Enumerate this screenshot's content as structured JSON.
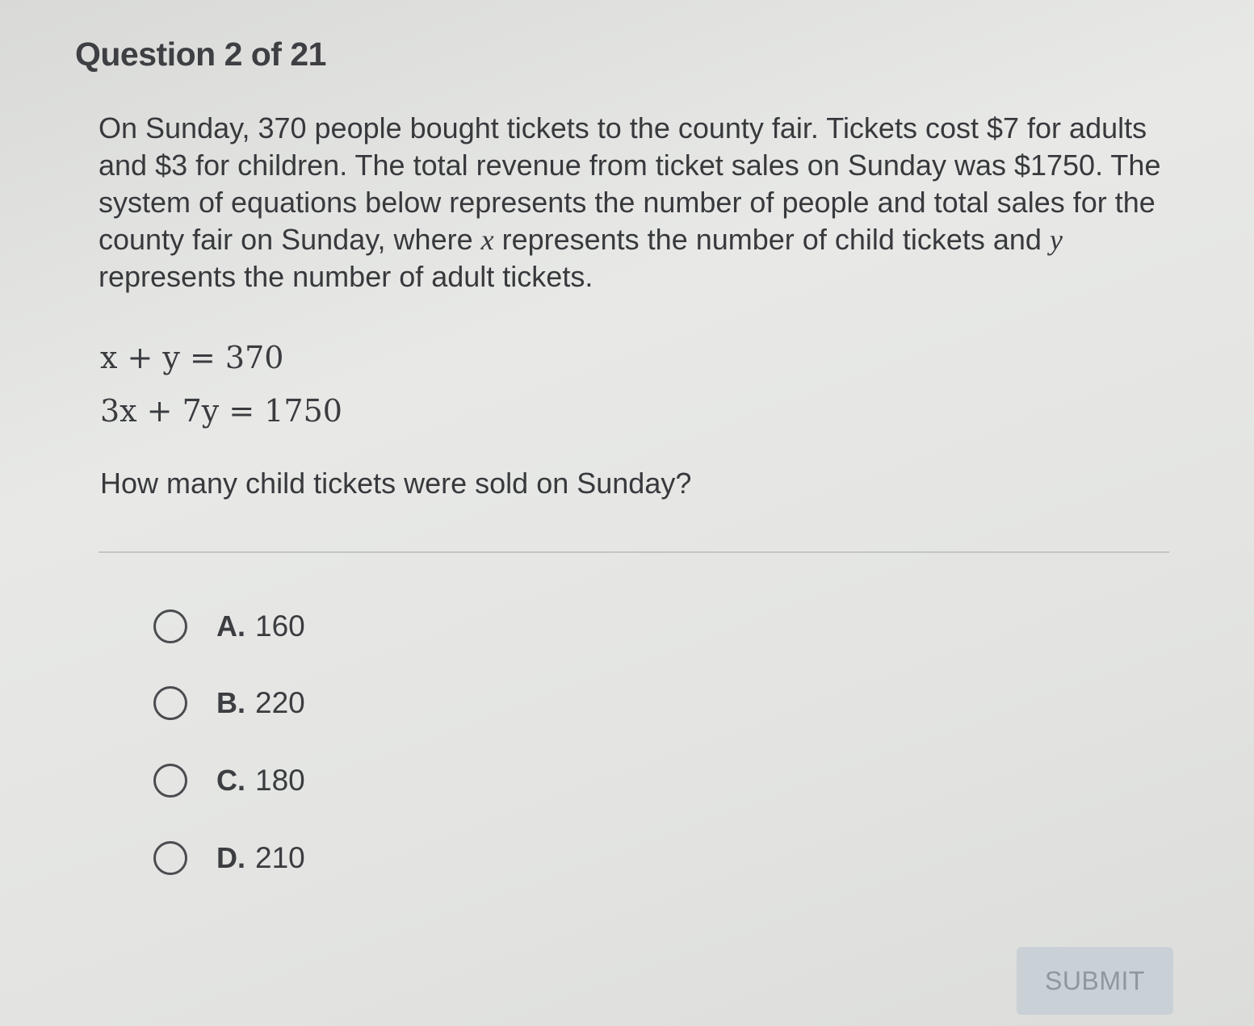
{
  "header": {
    "title": "Question 2 of 21"
  },
  "question": {
    "part1": "On Sunday, 370 people bought tickets to the county fair. Tickets cost $7 for adults and $3 for children. The total revenue from ticket sales on Sunday was $1750. The system of equations below represents the number of people and total sales for the county fair on Sunday, where ",
    "var_x": "x",
    "part2": " represents the number of child tickets and ",
    "var_y": "y",
    "part3": " represents the number of adult tickets.",
    "equations": [
      "x + y = 370",
      "3x + 7y = 1750"
    ],
    "sub_question": "How many child tickets were sold on Sunday?"
  },
  "choices": [
    {
      "letter": "A.",
      "value": "160"
    },
    {
      "letter": "B.",
      "value": "220"
    },
    {
      "letter": "C.",
      "value": "180"
    },
    {
      "letter": "D.",
      "value": "210"
    }
  ],
  "submit": {
    "label": "SUBMIT"
  },
  "colors": {
    "background": "#e4e5e3",
    "text": "#37393c",
    "submit_bg": "#c9d0d6",
    "submit_text": "#8f979e"
  }
}
